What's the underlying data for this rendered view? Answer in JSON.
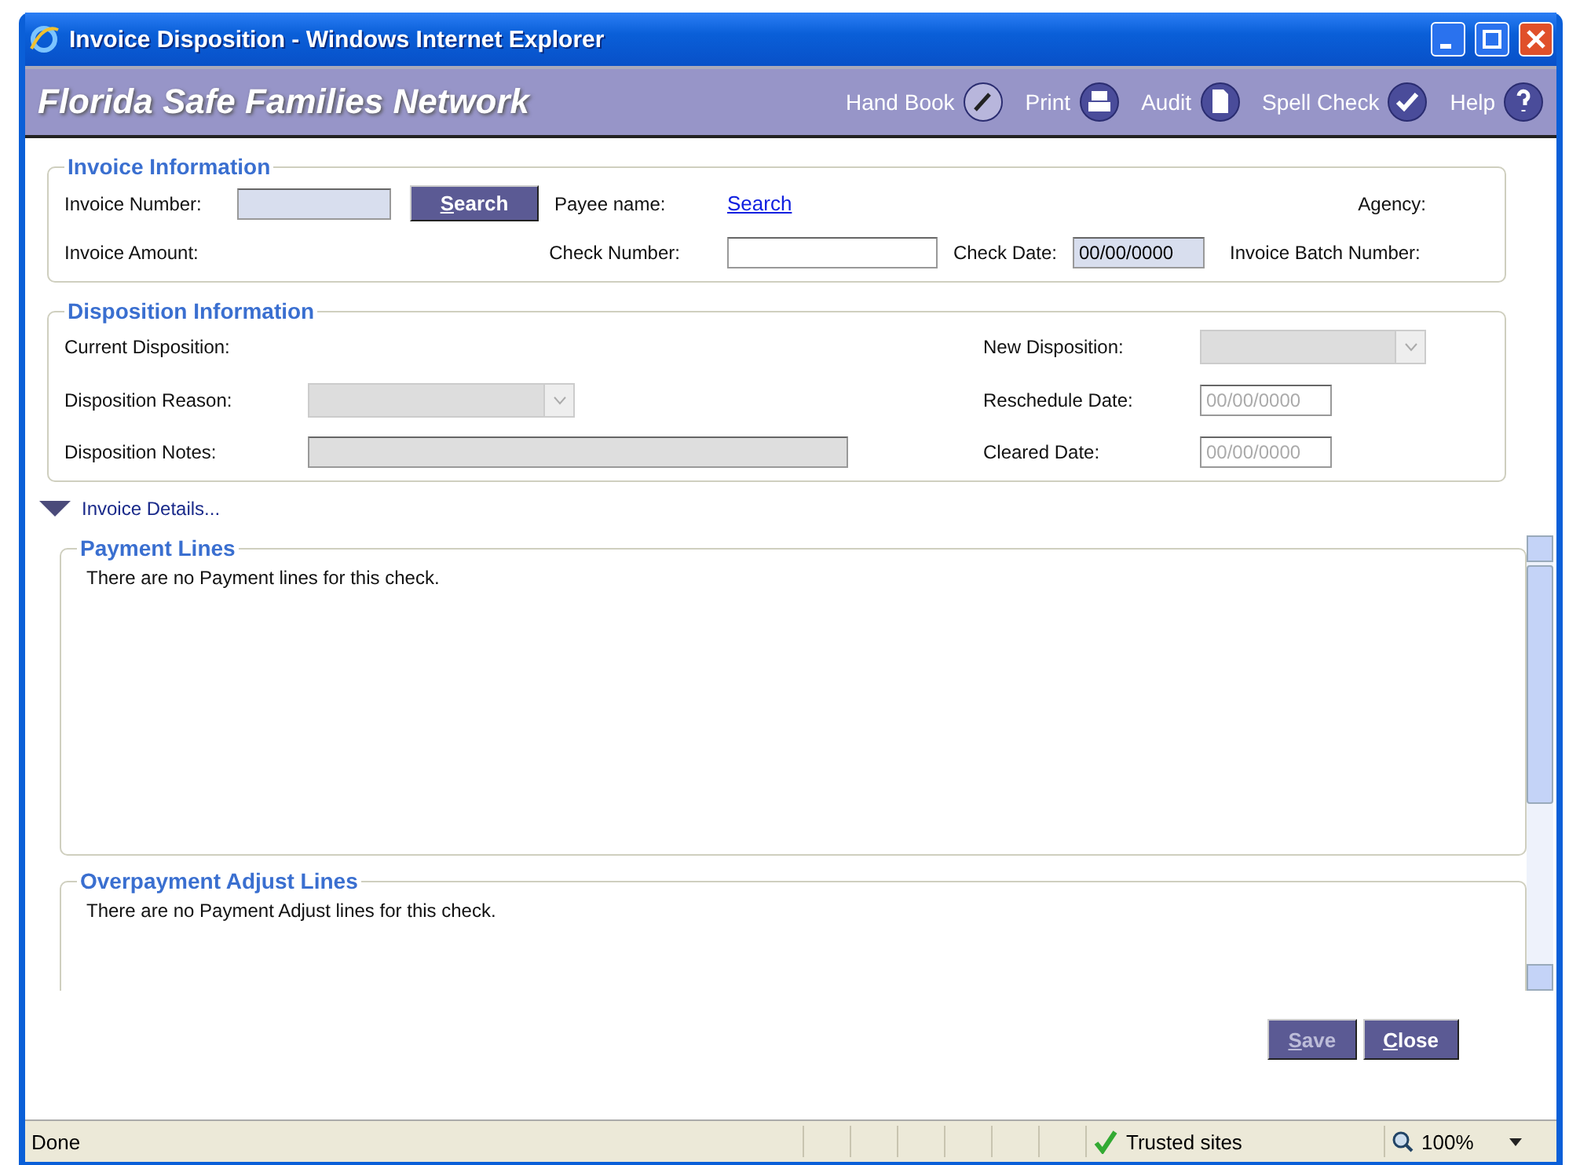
{
  "window": {
    "title": "Invoice Disposition - Windows Internet Explorer"
  },
  "header": {
    "title": "Florida Safe Families Network",
    "tools": [
      {
        "label": "Hand Book",
        "kind": "handbook"
      },
      {
        "label": "Print",
        "kind": "print"
      },
      {
        "label": "Audit",
        "kind": "audit"
      },
      {
        "label": "Spell Check",
        "kind": "spell"
      },
      {
        "label": "Help",
        "kind": "help"
      }
    ]
  },
  "invoice_information": {
    "legend": "Invoice Information",
    "invoice_number_label": "Invoice Number:",
    "search_button": "Search",
    "payee_label": "Payee name:",
    "payee_link": "Search",
    "agency_label": "Agency:",
    "amount_label": "Invoice Amount:",
    "check_number_label": "Check Number:",
    "check_date_label": "Check Date:",
    "check_date_value": "00/00/0000",
    "batch_label": "Invoice Batch Number:"
  },
  "disposition_information": {
    "legend": "Disposition Information",
    "current_label": "Current Disposition:",
    "new_label": "New Disposition:",
    "reason_label": "Disposition Reason:",
    "reschedule_label": "Reschedule Date:",
    "reschedule_value": "00/00/0000",
    "notes_label": "Disposition Notes:",
    "cleared_label": "Cleared Date:",
    "cleared_value": "00/00/0000",
    "disabled": true
  },
  "invoice_details": {
    "label": "Invoice Details...",
    "expanded": true
  },
  "payment_lines": {
    "legend": "Payment Lines",
    "message": "There are no Payment lines for this check."
  },
  "overpayment_lines": {
    "legend": "Overpayment Adjust Lines",
    "message": "There are no Payment Adjust lines for this check."
  },
  "buttons": [
    {
      "label": "Save",
      "disabled": true
    },
    {
      "label": "Close",
      "disabled": false
    }
  ],
  "status_bar": {
    "status": "Done",
    "zone": "Trusted sites",
    "zoom": "100%"
  }
}
